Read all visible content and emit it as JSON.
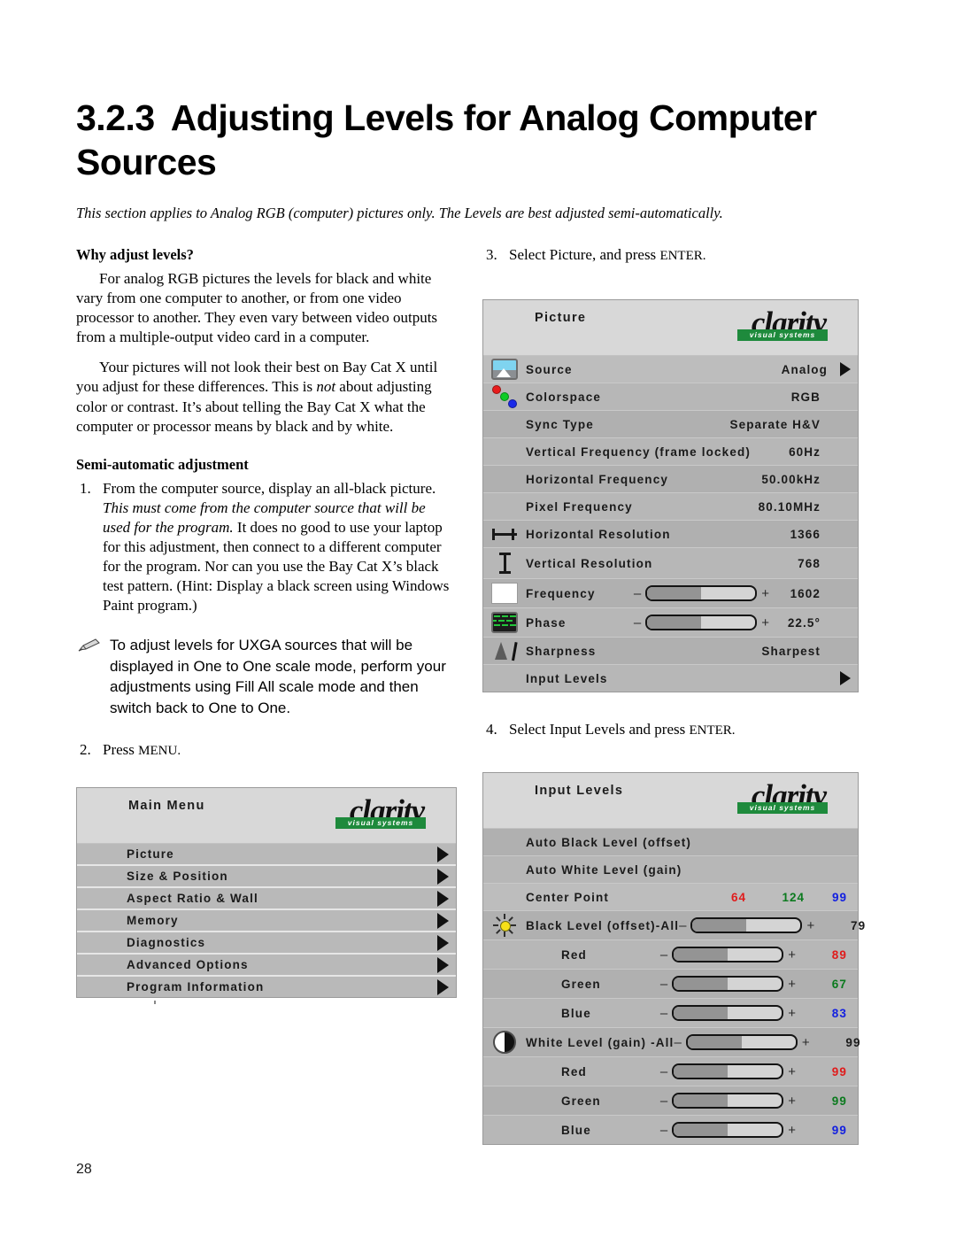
{
  "document": {
    "page_number": "28",
    "heading_number": "3.2.3",
    "heading_title": "Adjusting Levels for Analog Computer Sources",
    "intro": "This section applies to Analog RGB (computer) pictures only. The Levels are best adjusted semi-automatically."
  },
  "left_column": {
    "why_heading": "Why adjust levels?",
    "why_para_1": "For analog RGB pictures the levels for black and white vary from one computer to another, or from one video processor to another. They even vary between video outputs from a multiple-output video card in a computer.",
    "why_para_2_a": "Your pictures will not look their best on Bay Cat X until you adjust for these differences. This is ",
    "why_para_2_italic": "not",
    "why_para_2_b": " about adjusting color or contrast. It’s about telling the Bay Cat X what the computer or processor means by black and by white.",
    "semi_heading": "Semi-automatic adjustment",
    "step1_marker": "1.",
    "step1_a": "From the computer source, display an all-black picture. ",
    "step1_italic": "This must come from the computer source that will be used for the program.",
    "step1_b": " It does no good to use your laptop for this adjustment, then connect to a different computer for the program. Nor can you use the Bay Cat X’s black test pattern. (Hint: Display a black screen using Windows Paint program.)",
    "note_icon": "pencil-note-icon",
    "note_text": "To adjust levels for UXGA sources that will be displayed in One to One scale mode, perform your adjustments using Fill All scale mode and then switch back to One to One.",
    "step2_marker": "2.",
    "step2_text": "Press ",
    "step2_key": "MENU."
  },
  "right_column": {
    "step3_marker": "3.",
    "step3_text": "Select Picture, and press ",
    "step3_key": "ENTER.",
    "step4_marker": "4.",
    "step4_text": "Select Input Levels and press ",
    "step4_key": "ENTER."
  },
  "logo": {
    "word": "clarity",
    "tagline": "visual systems",
    "bar_color": "#1e8a3c"
  },
  "main_menu": {
    "title": "Main Menu",
    "items": [
      {
        "label": "Picture",
        "arrow": true
      },
      {
        "label": "Size & Position",
        "arrow": true
      },
      {
        "label": "Aspect Ratio & Wall",
        "arrow": true
      },
      {
        "label": "Memory",
        "arrow": true
      },
      {
        "label": "Diagnostics",
        "arrow": true
      },
      {
        "label": "Advanced Options",
        "arrow": true
      },
      {
        "label": "Program Information",
        "arrow": true
      }
    ]
  },
  "picture_menu": {
    "title": "Picture",
    "rows": [
      {
        "icon": "picture-source-icon",
        "label": "Source",
        "value": "Analog",
        "arrow": true,
        "type": "value"
      },
      {
        "icon": "rgb-dots-icon",
        "label": "Colorspace",
        "value": "RGB",
        "type": "value"
      },
      {
        "icon": "",
        "label": "Sync Type",
        "value": "Separate H&V",
        "type": "value"
      },
      {
        "icon": "",
        "label": "Vertical Frequency (frame locked)",
        "value": "60Hz",
        "type": "value"
      },
      {
        "icon": "",
        "label": "Horizontal Frequency",
        "value": "50.00kHz",
        "type": "value"
      },
      {
        "icon": "",
        "label": "Pixel Frequency",
        "value": "80.10MHz",
        "type": "value"
      },
      {
        "icon": "horizontal-resolution-icon",
        "label": "Horizontal Resolution",
        "value": "1366",
        "type": "value"
      },
      {
        "icon": "vertical-resolution-icon",
        "label": "Vertical Resolution",
        "value": "768",
        "type": "value"
      },
      {
        "icon": "white-square-icon",
        "label": "Frequency",
        "value": "1602",
        "type": "slider",
        "fill": 50
      },
      {
        "icon": "phase-pattern-icon",
        "label": "Phase",
        "value": "22.5°",
        "type": "slider",
        "fill": 50
      },
      {
        "icon": "sharpness-icon",
        "label": "Sharpness",
        "value": "Sharpest",
        "type": "value"
      },
      {
        "icon": "",
        "label": "Input Levels",
        "value": "",
        "arrow": true,
        "type": "value"
      }
    ]
  },
  "input_levels_menu": {
    "title": "Input Levels",
    "rows": [
      {
        "icon": "",
        "label": "Auto Black Level (offset)",
        "type": "plain"
      },
      {
        "icon": "",
        "label": "Auto White Level (gain)",
        "type": "plain"
      },
      {
        "icon": "",
        "label": "Center Point",
        "type": "centerpoint",
        "red": "64",
        "green": "124",
        "blue": "99"
      },
      {
        "icon": "brightness-sun-icon",
        "label": "Black Level (offset)-All",
        "type": "slider",
        "fill": 50,
        "value": "79",
        "color": "black",
        "indent": false
      },
      {
        "icon": "",
        "label": "Red",
        "type": "slider",
        "fill": 50,
        "value": "89",
        "color": "red",
        "indent": true
      },
      {
        "icon": "",
        "label": "Green",
        "type": "slider",
        "fill": 50,
        "value": "67",
        "color": "green",
        "indent": true
      },
      {
        "icon": "",
        "label": "Blue",
        "type": "slider",
        "fill": 50,
        "value": "83",
        "color": "blue",
        "indent": true
      },
      {
        "icon": "contrast-circle-icon",
        "label": "White Level (gain) -All",
        "type": "slider",
        "fill": 50,
        "value": "99",
        "color": "black",
        "indent": false
      },
      {
        "icon": "",
        "label": "Red",
        "type": "slider",
        "fill": 50,
        "value": "99",
        "color": "red",
        "indent": true
      },
      {
        "icon": "",
        "label": "Green",
        "type": "slider",
        "fill": 50,
        "value": "99",
        "color": "green",
        "indent": true
      },
      {
        "icon": "",
        "label": "Blue",
        "type": "slider",
        "fill": 50,
        "value": "99",
        "color": "blue",
        "indent": true
      }
    ]
  },
  "colors": {
    "value_red": "#e01b1b",
    "value_green": "#0b7a1e",
    "value_blue": "#1320e0",
    "menu_bg": "#b7b7b7",
    "menu_header_bg": "#d8d8d8"
  }
}
